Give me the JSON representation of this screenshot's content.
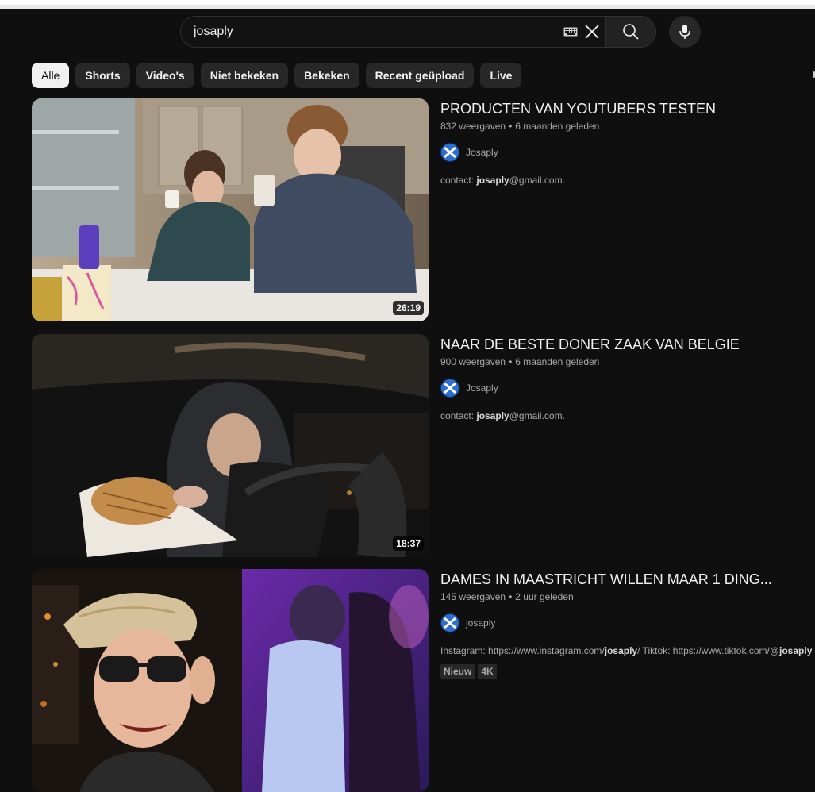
{
  "search": {
    "query": "josaply",
    "keyboard_icon": "keyboard-icon",
    "clear_icon": "close-icon",
    "search_icon": "search-icon",
    "mic_icon": "microphone-icon"
  },
  "chips": [
    {
      "label": "Alle",
      "active": true
    },
    {
      "label": "Shorts",
      "active": false
    },
    {
      "label": "Video's",
      "active": false
    },
    {
      "label": "Niet bekeken",
      "active": false
    },
    {
      "label": "Bekeken",
      "active": false
    },
    {
      "label": "Recent geüpload",
      "active": false
    },
    {
      "label": "Live",
      "active": false
    }
  ],
  "results": [
    {
      "title": "PRODUCTEN VAN YOUTUBERS TESTEN",
      "views": "832 weergaven",
      "age": "6 maanden geleden",
      "channel": "Josaply",
      "duration": "26:19",
      "desc_prefix": "contact: ",
      "desc_bold": "josaply",
      "desc_suffix": "@gmail.com."
    },
    {
      "title": "NAAR DE BESTE DONER ZAAK VAN BELGIE",
      "views": "900 weergaven",
      "age": "6 maanden geleden",
      "channel": "Josaply",
      "duration": "18:37",
      "desc_prefix": "contact: ",
      "desc_bold": "josaply",
      "desc_suffix": "@gmail.com."
    },
    {
      "title": "DAMES IN MAASTRICHT WILLEN MAAR 1 DING...",
      "views": "145 weergaven",
      "age": "2 uur geleden",
      "channel": "josaply",
      "desc_part1": "Instagram: https://www.instagram.com/",
      "desc_bold1": "josaply",
      "desc_part2": "/ Tiktok: https://www.tiktok.com/@",
      "desc_bold2": "josaply",
      "badges": [
        "Nieuw",
        "4K"
      ]
    }
  ],
  "colors": {
    "background": "#0f0f0f",
    "chip": "#272727",
    "chip_active": "#f1f1f1",
    "secondary_text": "#aaaaaa"
  }
}
